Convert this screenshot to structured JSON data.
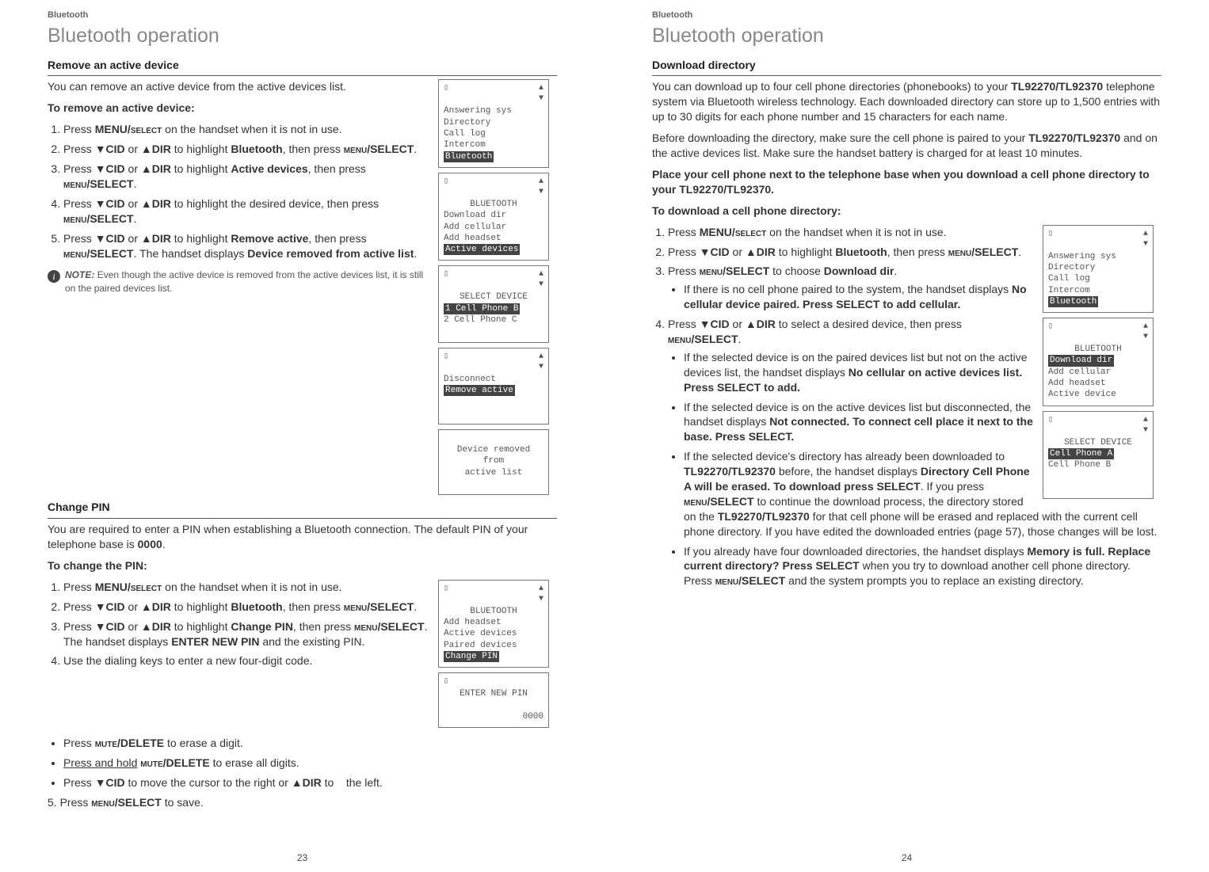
{
  "header_small": "Bluetooth",
  "page_title": "Bluetooth operation",
  "left": {
    "sec1_title": "Remove an active device",
    "sec1_intro": "You can remove an active device from the active devices list.",
    "sec1_proc_title": "To remove an active device:",
    "sec1_steps": [
      "Press MENU/SELECT on the handset when it is not in use.",
      "Press ▼CID or ▲DIR to highlight Bluetooth, then press MENU/SELECT.",
      "Press ▼CID or ▲DIR to highlight Active devices, then press MENU/SELECT.",
      "Press ▼CID or ▲DIR to highlight the desired device, then press MENU/SELECT.",
      "Press ▼CID or ▲DIR to highlight Remove active, then press MENU/SELECT. The handset displays Device removed from active list."
    ],
    "sec1_note_label": "NOTE:",
    "sec1_note_text": "Even though the active device is removed from the active devices list, it is still on the paired devices list.",
    "sec2_title": "Change PIN",
    "sec2_intro": "You are required to enter a PIN when establishing a Bluetooth connection. The default PIN of your telephone base is 0000.",
    "sec2_proc_title": "To change the PIN:",
    "sec2_steps": [
      "Press MENU/SELECT on the handset when it is not in use.",
      "Press ▼CID or ▲DIR to highlight Bluetooth, then press MENU/SELECT.",
      "Press ▼CID or ▲DIR to highlight Change PIN, then press MENU/SELECT. The handset displays ENTER NEW PIN and the existing PIN.",
      "Use the dialing keys to enter a new four-digit code."
    ],
    "sec2_sub": [
      "Press MUTE/DELETE to erase a digit.",
      "Press and hold MUTE/DELETE to erase all digits.",
      "Press ▼CID to move the cursor to the right or ▲DIR to    the left."
    ],
    "sec2_final": "5. Press MENU/SELECT to save.",
    "screens1": {
      "s1": [
        "Answering sys",
        "Directory",
        "Call log",
        "Intercom"
      ],
      "s1_hl": "Bluetooth",
      "s2_title": "BLUETOOTH",
      "s2": [
        "Download dir",
        "Add cellular",
        "Add headset"
      ],
      "s2_hl": "Active devices",
      "s3_title": "SELECT DEVICE",
      "s3_hl": "1 Cell Phone B",
      "s3_b": "2 Cell Phone C",
      "s4_a": "Disconnect",
      "s4_hl": "Remove active",
      "s5_a": "Device removed",
      "s5_b": "from",
      "s5_c": "active list"
    },
    "screens2": {
      "s1_title": "BLUETOOTH",
      "s1": [
        "Add headset",
        "Active devices",
        "Paired devices"
      ],
      "s1_hl": "Change PIN",
      "s2_title": "ENTER NEW PIN",
      "s2_val": "0000"
    },
    "pgnum": "23"
  },
  "right": {
    "sec1_title": "Download directory",
    "sec1_p1": "You can download up to four cell phone directories (phonebooks) to your TL92270/TL92370 telephone system via Bluetooth wireless technology. Each downloaded directory can store up to 1,500 entries with up to 30 digits for each phone number and 15 characters for each name.",
    "sec1_p2": "Before downloading the directory, make sure the cell phone is paired to your TL92270/TL92370 and on the active devices list. Make sure the handset battery is charged for at least 10 minutes.",
    "sec1_p3": "Place your cell phone next to the telephone base when you download a cell phone directory to your TL92270/TL92370.",
    "sec1_proc_title": "To download a cell phone directory:",
    "step1": "Press MENU/SELECT on the handset when it is not in use.",
    "step2": "Press ▼CID or ▲DIR to highlight Bluetooth, then press MENU/SELECT.",
    "step3": "Press MENU/SELECT to choose Download dir.",
    "step3_sub1": "If there is no cell phone paired to the system, the handset displays No cellular device paired. Press SELECT to add cellular.",
    "step4": "Press ▼CID or ▲DIR to select a desired device, then press MENU/SELECT.",
    "step4_sub1": "If the selected device is on the paired devices list but not on the active devices list, the handset displays No cellular on active devices list. Press SELECT to add.",
    "step4_sub2": "If the selected device is on the active devices list but disconnected, the handset displays Not connected. To connect cell place it next to the base. Press SELECT.",
    "step4_sub3": "If the selected device's directory has already been downloaded to TL92270/TL92370 before, the handset displays Directory Cell Phone A will be erased. To download press SELECT. If you press MENU/SELECT to continue the download process, the directory stored on the TL92270/TL92370 for that cell phone will be erased and replaced with the current cell phone directory. If you have edited the downloaded entries (page 57), those changes will be lost.",
    "step4_sub4": "If you already have four downloaded directories, the handset displays Memory is full. Replace current directory? Press SELECT when you try to download another cell phone directory. Press MENU/SELECT and the system prompts you to replace an existing directory.",
    "screens": {
      "s1": [
        "Answering sys",
        "Directory",
        "Call log",
        "Intercom"
      ],
      "s1_hl": "Bluetooth",
      "s2_title": "BLUETOOTH",
      "s2_hl": "Download dir",
      "s2": [
        "Add cellular",
        "Add headset",
        "Active device"
      ],
      "s3_title": "SELECT DEVICE",
      "s3_hl": "Cell Phone A",
      "s3_b": "Cell Phone B"
    },
    "pgnum": "24"
  }
}
